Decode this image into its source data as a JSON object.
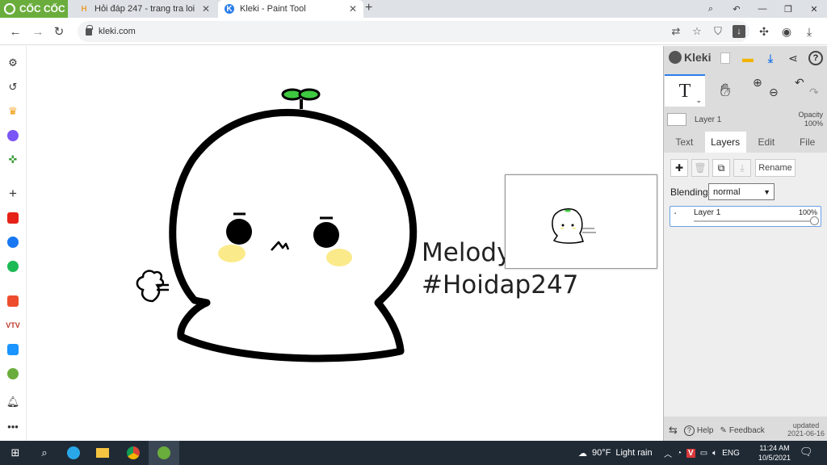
{
  "browser": {
    "brand": "CỐC CỐC",
    "tabs": [
      {
        "title": "Hỏi đáp 247 - trang tra loi",
        "favicon": "H"
      },
      {
        "title": "Kleki - Paint Tool",
        "favicon": "K",
        "active": true
      }
    ],
    "url": "kleki.com"
  },
  "drawing": {
    "text_line1": "Melody",
    "text_line2": "#Hoidap247",
    "colors": {
      "sprout": "#3fc940",
      "cheek": "#fbea8a",
      "ink": "#000000"
    }
  },
  "kleki": {
    "logo": "Kleki",
    "layer_name": "Layer 1",
    "opacity_label": "Opacity",
    "opacity_value": "100%",
    "tabs": [
      "Text",
      "Layers",
      "Edit",
      "File"
    ],
    "active_tab": "Layers",
    "rename_label": "Rename",
    "blending_label": "Blending",
    "blending_value": "normal",
    "layers": [
      {
        "name": "Layer 1",
        "opacity": "100%"
      }
    ],
    "help_label": "Help",
    "feedback_label": "Feedback",
    "updated_label": "updated",
    "updated_date": "2021-06-16"
  },
  "taskbar": {
    "weather": "90°F",
    "weather_desc": "Light rain",
    "lang": "ENG",
    "time": "11:24 AM",
    "date": "10/5/2021"
  }
}
